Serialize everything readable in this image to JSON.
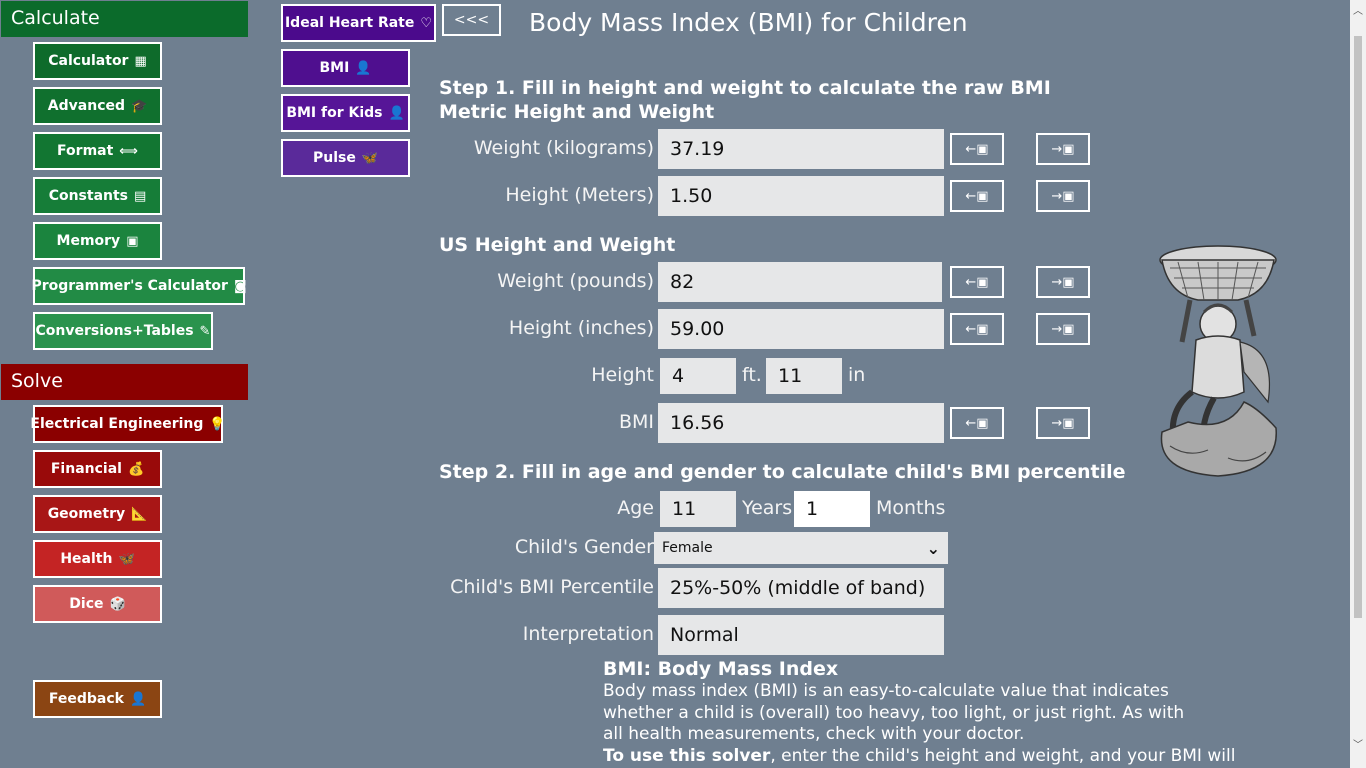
{
  "left_nav": {
    "calculate_header": "Calculate",
    "calculate_items": [
      {
        "label": "Calculator",
        "icon": "▦"
      },
      {
        "label": "Advanced",
        "icon": "🎓"
      },
      {
        "label": "Format",
        "icon": "⟺"
      },
      {
        "label": "Constants",
        "icon": "▤"
      },
      {
        "label": "Memory",
        "icon": "▣"
      },
      {
        "label": "Programmer's Calculator",
        "icon": "◙"
      },
      {
        "label": "Conversions+Tables",
        "icon": "✎"
      }
    ],
    "solve_header": "Solve",
    "solve_items": [
      {
        "label": "Electrical Engineering",
        "icon": "💡"
      },
      {
        "label": "Financial",
        "icon": "💰"
      },
      {
        "label": "Geometry",
        "icon": "📐"
      },
      {
        "label": "Health",
        "icon": "🦋"
      },
      {
        "label": "Dice",
        "icon": "🎲"
      }
    ],
    "feedback": {
      "label": "Feedback",
      "icon": "👤"
    }
  },
  "sub_nav": {
    "items": [
      {
        "label": "Ideal Heart Rate",
        "icon": "♡"
      },
      {
        "label": "BMI",
        "icon": "👤"
      },
      {
        "label": "BMI for Kids",
        "icon": "👤"
      },
      {
        "label": "Pulse",
        "icon": "🦋"
      }
    ],
    "back_label": "<<<"
  },
  "page": {
    "title": "Body Mass Index (BMI) for Children",
    "step1": "Step 1. Fill in height and weight to calculate the raw BMI",
    "metric_header": "Metric Height and Weight",
    "us_header": "US Height and Weight",
    "step2": "Step 2. Fill in age and gender to calculate child's BMI percentile",
    "arrow_in": "←▣",
    "arrow_out": "→▣"
  },
  "fields": {
    "weight_kg": {
      "label": "Weight (kilograms)",
      "value": "37.19"
    },
    "height_m": {
      "label": "Height (Meters)",
      "value": "1.50"
    },
    "weight_lb": {
      "label": "Weight (pounds)",
      "value": "82"
    },
    "height_in": {
      "label": "Height (inches)",
      "value": "59.00"
    },
    "height_ftin": {
      "label": "Height",
      "ft": "4",
      "ft_unit": "ft.",
      "in": "11",
      "in_unit": "in"
    },
    "bmi": {
      "label": "BMI",
      "value": "16.56"
    },
    "age": {
      "label": "Age",
      "years": "11",
      "years_unit": "Years",
      "months": "1",
      "months_unit": "Months"
    },
    "gender": {
      "label": "Child's Gender",
      "value": "Female"
    },
    "percentile": {
      "label": "Child's BMI Percentile",
      "value": "25%-50% (middle of band)"
    },
    "interpretation": {
      "label": "Interpretation",
      "value": "Normal"
    }
  },
  "info": {
    "title": "BMI: Body Mass Index",
    "body": "Body mass index (BMI) is an easy-to-calculate value that indicates whether a child is (overall) too heavy, too light, or just right. As with all health measurements, check with your doctor.",
    "usage_bold": "To use this solver",
    "usage_rest": ", enter the child's height and weight, and your BMI will"
  },
  "colors": {
    "background": "#6f7f90",
    "calculate": "#0b6b2b",
    "solve": "#8b0000",
    "purple": "#4b0a8c",
    "feedback": "#8b4513"
  }
}
